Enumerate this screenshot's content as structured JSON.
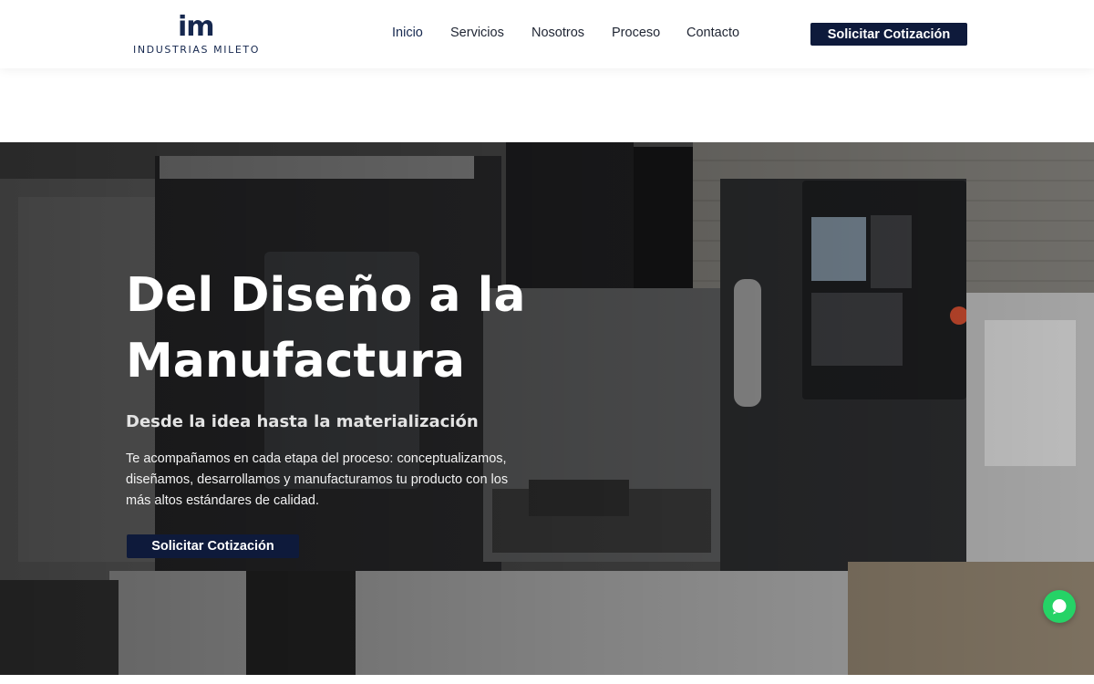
{
  "brand": {
    "logo_mark": "im",
    "name": "INDUSTRIAS MILETO",
    "primary_color": "#0e1a3b",
    "accent_color": "#16284f"
  },
  "nav": {
    "items": [
      {
        "label": "Inicio",
        "active": true
      },
      {
        "label": "Servicios",
        "active": false
      },
      {
        "label": "Nosotros",
        "active": false
      },
      {
        "label": "Proceso",
        "active": false
      },
      {
        "label": "Contacto",
        "active": false
      }
    ],
    "cta_label": "Solicitar Cotización"
  },
  "hero": {
    "title_line1": "Del Diseño a la",
    "title_line2": "Manufactura",
    "subtitle": "Desde la idea hasta la materialización",
    "description": "Te acompañamos en cada etapa del proceso: conceptualizamos, diseñamos, desarrollamos y manufacturamos tu producto con los más altos estándares de calidad.",
    "cta_label": "Solicitar Cotización",
    "background": "cnc-machine-workshop-photo"
  },
  "chat": {
    "icon": "chat-bubble-icon",
    "color": "#25d366"
  }
}
